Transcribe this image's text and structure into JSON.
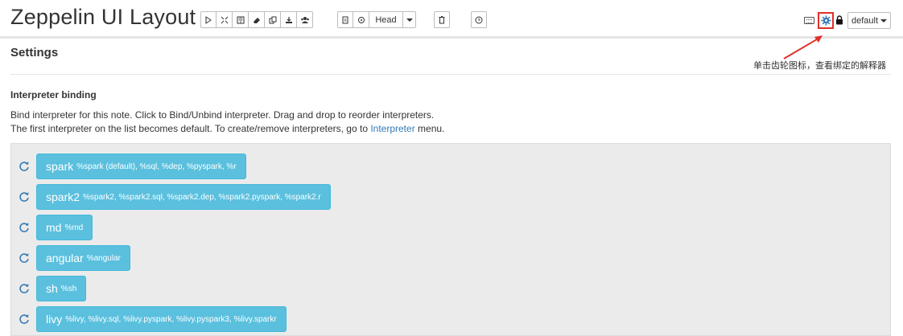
{
  "header": {
    "title": "Zeppelin UI Layout",
    "head_label": "Head",
    "default_label": "default"
  },
  "annotation": "单击齿轮图标，查看绑定的解释器",
  "settings": {
    "title": "Settings",
    "binding_title": "Interpreter binding",
    "help_line1": "Bind interpreter for this note. Click to Bind/Unbind interpreter. Drag and drop to reorder interpreters.",
    "help_line2_prefix": "The first interpreter on the list becomes default. To create/remove interpreters, go to ",
    "help_line2_link": "Interpreter",
    "help_line2_suffix": " menu."
  },
  "interpreters": [
    {
      "name": "spark",
      "aliases": "%spark (default), %sql, %dep, %pyspark, %r"
    },
    {
      "name": "spark2",
      "aliases": "%spark2, %spark2.sql, %spark2.dep, %spark2.pyspark, %spark2.r"
    },
    {
      "name": "md",
      "aliases": "%md"
    },
    {
      "name": "angular",
      "aliases": "%angular"
    },
    {
      "name": "sh",
      "aliases": "%sh"
    },
    {
      "name": "livy",
      "aliases": "%livy, %livy.sql, %livy.pyspark, %livy.pyspark3, %livy.sparkr"
    }
  ],
  "colors": {
    "accent": "#5bc0de",
    "highlight_box": "#e0302a",
    "link": "#337ab7",
    "gear": "#337ab7"
  }
}
